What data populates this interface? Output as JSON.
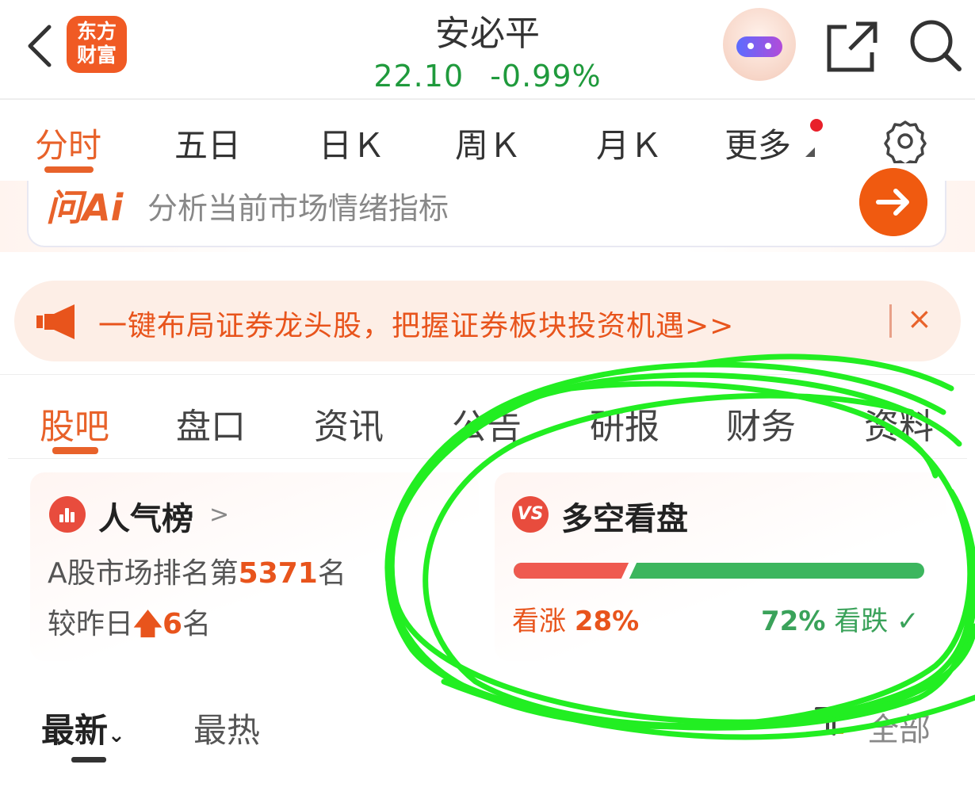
{
  "header": {
    "logo_line1": "东方",
    "logo_line2": "财富",
    "stock_name": "安必平",
    "price": "22.10",
    "change": "-0.99%"
  },
  "chart_tabs": [
    "分时",
    "五日",
    "日Ｋ",
    "周Ｋ",
    "月Ｋ",
    "更多"
  ],
  "ask_ai": {
    "logo": "问Ai",
    "prompt": "分析当前市场情绪指标"
  },
  "banner": {
    "text": "一键布局证券龙头股，把握证券板块投资机遇>>",
    "close": "×"
  },
  "content_tabs": [
    "股吧",
    "盘口",
    "资讯",
    "公告",
    "研报",
    "财务",
    "资料"
  ],
  "popularity": {
    "title": "人气榜",
    "arrow": ">",
    "rank_prefix": "A股市场排名第",
    "rank": "5371",
    "rank_suffix": "名",
    "change_prefix": "较昨日",
    "change_arrow": "🡅",
    "change_value": "6",
    "change_suffix": "名"
  },
  "sentiment": {
    "icon": "VS",
    "title": "多空看盘",
    "bull_label": "看涨",
    "bull_pct": "28%",
    "bear_pct": "72%",
    "bear_label": "看跌",
    "check": "✓",
    "bull_ratio": 0.28
  },
  "feed": {
    "latest": "最新",
    "hot": "最热",
    "filter_value": "全部"
  },
  "colors": {
    "accent": "#e8622a",
    "up": "#ef5a50",
    "down": "#3cb65e",
    "annotation": "#22dd22"
  }
}
